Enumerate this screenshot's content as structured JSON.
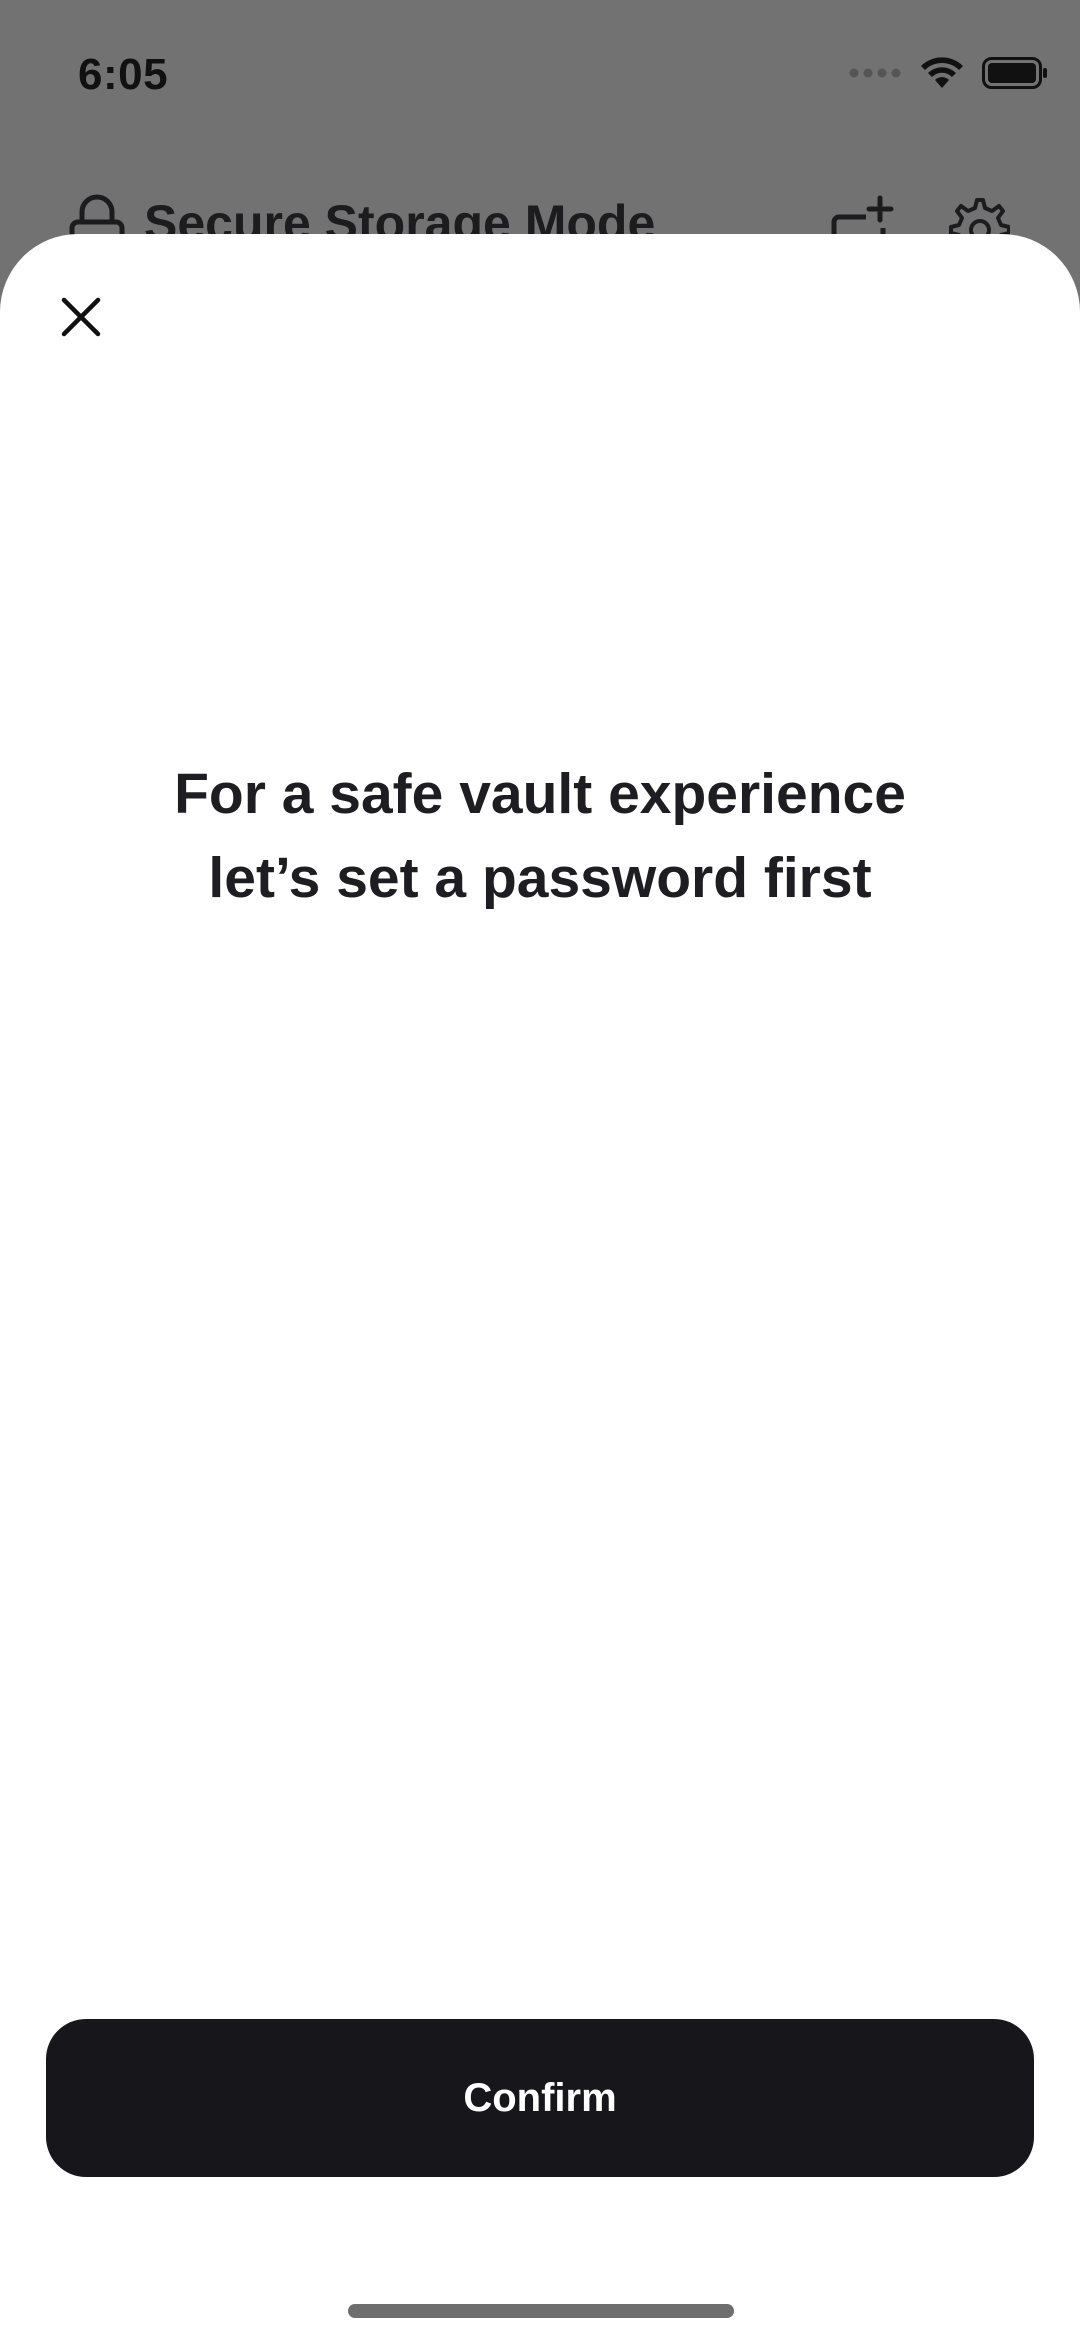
{
  "status_bar": {
    "time": "6:05",
    "icons": [
      "signal-icon",
      "wifi-icon",
      "battery-icon"
    ]
  },
  "background_app": {
    "title": "Secure Storage Mode",
    "icons": [
      "lock-folder-icon",
      "add-folder-icon",
      "gear-icon"
    ]
  },
  "sheet": {
    "close_icon": "close-icon",
    "message_line1": "For a safe vault experience",
    "message_line2": "let’s set a password first",
    "confirm_label": "Confirm"
  },
  "colors": {
    "dimmed_background": "#727272",
    "sheet_background": "#ffffff",
    "button_background": "#17171b",
    "button_text": "#ffffff",
    "text_primary": "#1e1e22"
  }
}
